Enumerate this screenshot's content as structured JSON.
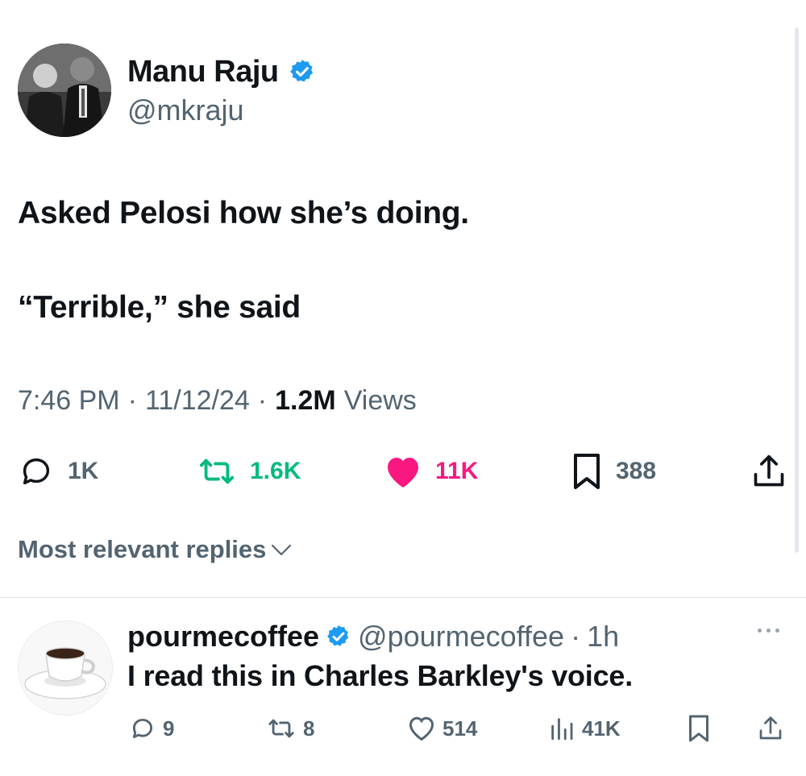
{
  "author": {
    "display_name": "Manu Raju",
    "handle": "@mkraju",
    "verified_icon": "verified-badge-icon"
  },
  "tweet": {
    "line1": "Asked Pelosi how she’s doing.",
    "line2": "“Terrible,” she said",
    "time": "7:46 PM",
    "separator": "·",
    "date": "11/12/24",
    "views_count": "1.2M",
    "views_label": "Views"
  },
  "actions": {
    "replies": "1K",
    "reposts": "1.6K",
    "likes": "11K",
    "bookmarks": "388"
  },
  "replies_sort": {
    "label": "Most relevant replies"
  },
  "reply": {
    "display_name": "pourmecoffee",
    "handle": "@pourmecoffee",
    "separator": "·",
    "time": "1h",
    "text": "I read this in Charles Barkley's voice.",
    "counts": {
      "replies": "9",
      "reposts": "8",
      "likes": "514",
      "views": "41K"
    }
  },
  "colors": {
    "text": "#0f1419",
    "muted": "#536471",
    "verified": "#1d9bf0",
    "repost_active": "#00ba7c",
    "like_active": "#f91880"
  }
}
